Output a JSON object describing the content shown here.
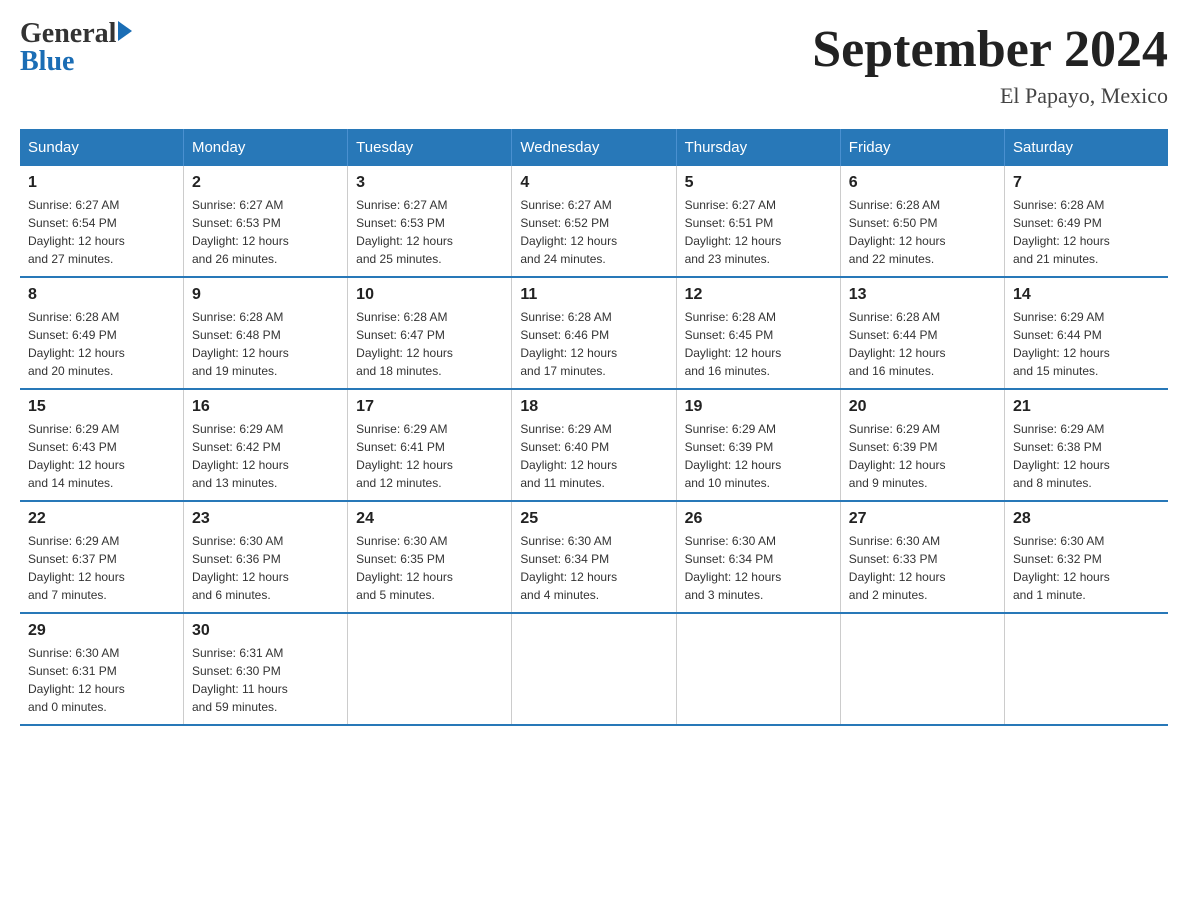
{
  "header": {
    "logo_general": "General",
    "logo_blue": "Blue",
    "main_title": "September 2024",
    "subtitle": "El Papayo, Mexico"
  },
  "weekdays": [
    "Sunday",
    "Monday",
    "Tuesday",
    "Wednesday",
    "Thursday",
    "Friday",
    "Saturday"
  ],
  "weeks": [
    [
      {
        "day": "1",
        "sunrise": "6:27 AM",
        "sunset": "6:54 PM",
        "daylight": "12 hours and 27 minutes."
      },
      {
        "day": "2",
        "sunrise": "6:27 AM",
        "sunset": "6:53 PM",
        "daylight": "12 hours and 26 minutes."
      },
      {
        "day": "3",
        "sunrise": "6:27 AM",
        "sunset": "6:53 PM",
        "daylight": "12 hours and 25 minutes."
      },
      {
        "day": "4",
        "sunrise": "6:27 AM",
        "sunset": "6:52 PM",
        "daylight": "12 hours and 24 minutes."
      },
      {
        "day": "5",
        "sunrise": "6:27 AM",
        "sunset": "6:51 PM",
        "daylight": "12 hours and 23 minutes."
      },
      {
        "day": "6",
        "sunrise": "6:28 AM",
        "sunset": "6:50 PM",
        "daylight": "12 hours and 22 minutes."
      },
      {
        "day": "7",
        "sunrise": "6:28 AM",
        "sunset": "6:49 PM",
        "daylight": "12 hours and 21 minutes."
      }
    ],
    [
      {
        "day": "8",
        "sunrise": "6:28 AM",
        "sunset": "6:49 PM",
        "daylight": "12 hours and 20 minutes."
      },
      {
        "day": "9",
        "sunrise": "6:28 AM",
        "sunset": "6:48 PM",
        "daylight": "12 hours and 19 minutes."
      },
      {
        "day": "10",
        "sunrise": "6:28 AM",
        "sunset": "6:47 PM",
        "daylight": "12 hours and 18 minutes."
      },
      {
        "day": "11",
        "sunrise": "6:28 AM",
        "sunset": "6:46 PM",
        "daylight": "12 hours and 17 minutes."
      },
      {
        "day": "12",
        "sunrise": "6:28 AM",
        "sunset": "6:45 PM",
        "daylight": "12 hours and 16 minutes."
      },
      {
        "day": "13",
        "sunrise": "6:28 AM",
        "sunset": "6:44 PM",
        "daylight": "12 hours and 16 minutes."
      },
      {
        "day": "14",
        "sunrise": "6:29 AM",
        "sunset": "6:44 PM",
        "daylight": "12 hours and 15 minutes."
      }
    ],
    [
      {
        "day": "15",
        "sunrise": "6:29 AM",
        "sunset": "6:43 PM",
        "daylight": "12 hours and 14 minutes."
      },
      {
        "day": "16",
        "sunrise": "6:29 AM",
        "sunset": "6:42 PM",
        "daylight": "12 hours and 13 minutes."
      },
      {
        "day": "17",
        "sunrise": "6:29 AM",
        "sunset": "6:41 PM",
        "daylight": "12 hours and 12 minutes."
      },
      {
        "day": "18",
        "sunrise": "6:29 AM",
        "sunset": "6:40 PM",
        "daylight": "12 hours and 11 minutes."
      },
      {
        "day": "19",
        "sunrise": "6:29 AM",
        "sunset": "6:39 PM",
        "daylight": "12 hours and 10 minutes."
      },
      {
        "day": "20",
        "sunrise": "6:29 AM",
        "sunset": "6:39 PM",
        "daylight": "12 hours and 9 minutes."
      },
      {
        "day": "21",
        "sunrise": "6:29 AM",
        "sunset": "6:38 PM",
        "daylight": "12 hours and 8 minutes."
      }
    ],
    [
      {
        "day": "22",
        "sunrise": "6:29 AM",
        "sunset": "6:37 PM",
        "daylight": "12 hours and 7 minutes."
      },
      {
        "day": "23",
        "sunrise": "6:30 AM",
        "sunset": "6:36 PM",
        "daylight": "12 hours and 6 minutes."
      },
      {
        "day": "24",
        "sunrise": "6:30 AM",
        "sunset": "6:35 PM",
        "daylight": "12 hours and 5 minutes."
      },
      {
        "day": "25",
        "sunrise": "6:30 AM",
        "sunset": "6:34 PM",
        "daylight": "12 hours and 4 minutes."
      },
      {
        "day": "26",
        "sunrise": "6:30 AM",
        "sunset": "6:34 PM",
        "daylight": "12 hours and 3 minutes."
      },
      {
        "day": "27",
        "sunrise": "6:30 AM",
        "sunset": "6:33 PM",
        "daylight": "12 hours and 2 minutes."
      },
      {
        "day": "28",
        "sunrise": "6:30 AM",
        "sunset": "6:32 PM",
        "daylight": "12 hours and 1 minute."
      }
    ],
    [
      {
        "day": "29",
        "sunrise": "6:30 AM",
        "sunset": "6:31 PM",
        "daylight": "12 hours and 0 minutes."
      },
      {
        "day": "30",
        "sunrise": "6:31 AM",
        "sunset": "6:30 PM",
        "daylight": "11 hours and 59 minutes."
      },
      null,
      null,
      null,
      null,
      null
    ]
  ],
  "labels": {
    "sunrise": "Sunrise:",
    "sunset": "Sunset:",
    "daylight": "Daylight:"
  }
}
